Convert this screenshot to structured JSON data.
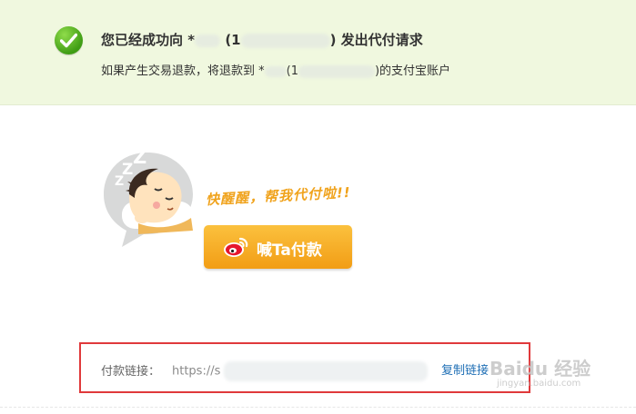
{
  "banner": {
    "title_prefix": "您已经成功向 *",
    "title_paren_open": "(1",
    "title_suffix": ") 发出代付请求",
    "subtitle_prefix": "如果产生交易退款，将退款到 *",
    "subtitle_paren_open": "(1",
    "subtitle_suffix": ")的支付宝账户"
  },
  "promo": {
    "slogan": "快醒醒，帮我代付啦!!",
    "shout_button": "喊Ta付款"
  },
  "payment_link": {
    "label": "付款链接：",
    "url_visible": "https://s",
    "copy_label": "复制链接"
  },
  "watermark": {
    "text": "Baidu 经验",
    "sub": "jingyan.baidu.com"
  },
  "colors": {
    "banner_bg": "#f0f8df",
    "check_green": "#4caf1a",
    "button_orange": "#f6aa22",
    "slogan_orange": "#f0a31d",
    "highlight_red": "#e0393b",
    "link_blue": "#1f6fb5"
  },
  "icons": {
    "success": "check-circle-icon",
    "mascot": "sleeping-mascot-icon",
    "weibo": "weibo-icon"
  }
}
